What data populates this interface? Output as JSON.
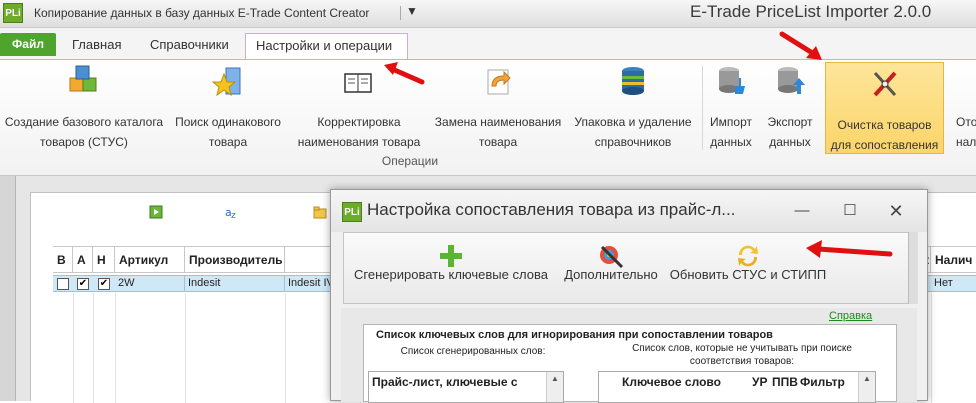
{
  "window": {
    "logo": "PLi",
    "title": "Копирование данных в базу данных E-Trade Content Creator",
    "app_name": "E-Trade PriceList Importer 2.0.0"
  },
  "tabs": {
    "file": "Файл",
    "items": [
      "Главная",
      "Справочники",
      "Настройки и операции"
    ]
  },
  "ribbon": {
    "buttons": [
      {
        "label": "Создание базового каталога товаров (СТУС)",
        "icon": "catalog-cubes-icon"
      },
      {
        "label": "Поиск одинакового товара",
        "icon": "search-star-icon"
      },
      {
        "label": "Корректировка наименования товара",
        "icon": "book-edit-icon"
      },
      {
        "label": "Замена наименования товара",
        "icon": "replace-arrow-icon"
      },
      {
        "label": "Упаковка и удаление справочников",
        "icon": "database-pack-icon"
      },
      {
        "label": "Импорт данных",
        "icon": "database-import-icon"
      },
      {
        "label": "Экспорт данных",
        "icon": "database-export-icon"
      },
      {
        "label": "Очистка товаров для сопоставления",
        "icon": "clean-tools-icon"
      },
      {
        "label": "Ото нали",
        "icon": "more-icon"
      }
    ],
    "group_label": "Операции"
  },
  "table": {
    "headers": [
      "В",
      "А",
      "Н",
      "Артикул",
      "Производитель"
    ],
    "right_headers": [
      "к",
      "Налич"
    ],
    "row": {
      "article": "2W",
      "manufacturer": "Indesit",
      "name": "Indesit IV",
      "availability": "Нет"
    }
  },
  "dialog": {
    "logo": "PLi",
    "title": "Настройка сопоставления товара из прайс-л...",
    "toolbar": [
      {
        "label": "Сгенерировать ключевые слова",
        "icon": "plus-icon"
      },
      {
        "label": "Дополнительно",
        "icon": "palette-tools-icon"
      },
      {
        "label": "Обновить СТУС и СТИПП",
        "icon": "refresh-icon"
      }
    ],
    "help": "Справка",
    "panel_title": "Список ключевых слов для игнорирования при сопоставлении товаров",
    "generated_label": "Список сгенерированных слов:",
    "ignored_label": "Список слов, которые не учитывать при поиске соответствия товаров:",
    "left_header": "Прайс-лист, ключевые с",
    "right_headers": [
      "Ключевое слово",
      "УР",
      "ППВ",
      "Фильтр"
    ]
  },
  "colors": {
    "accent_green": "#4ea42d",
    "highlight": "#fcd56a",
    "arrow_red": "#e01010"
  }
}
